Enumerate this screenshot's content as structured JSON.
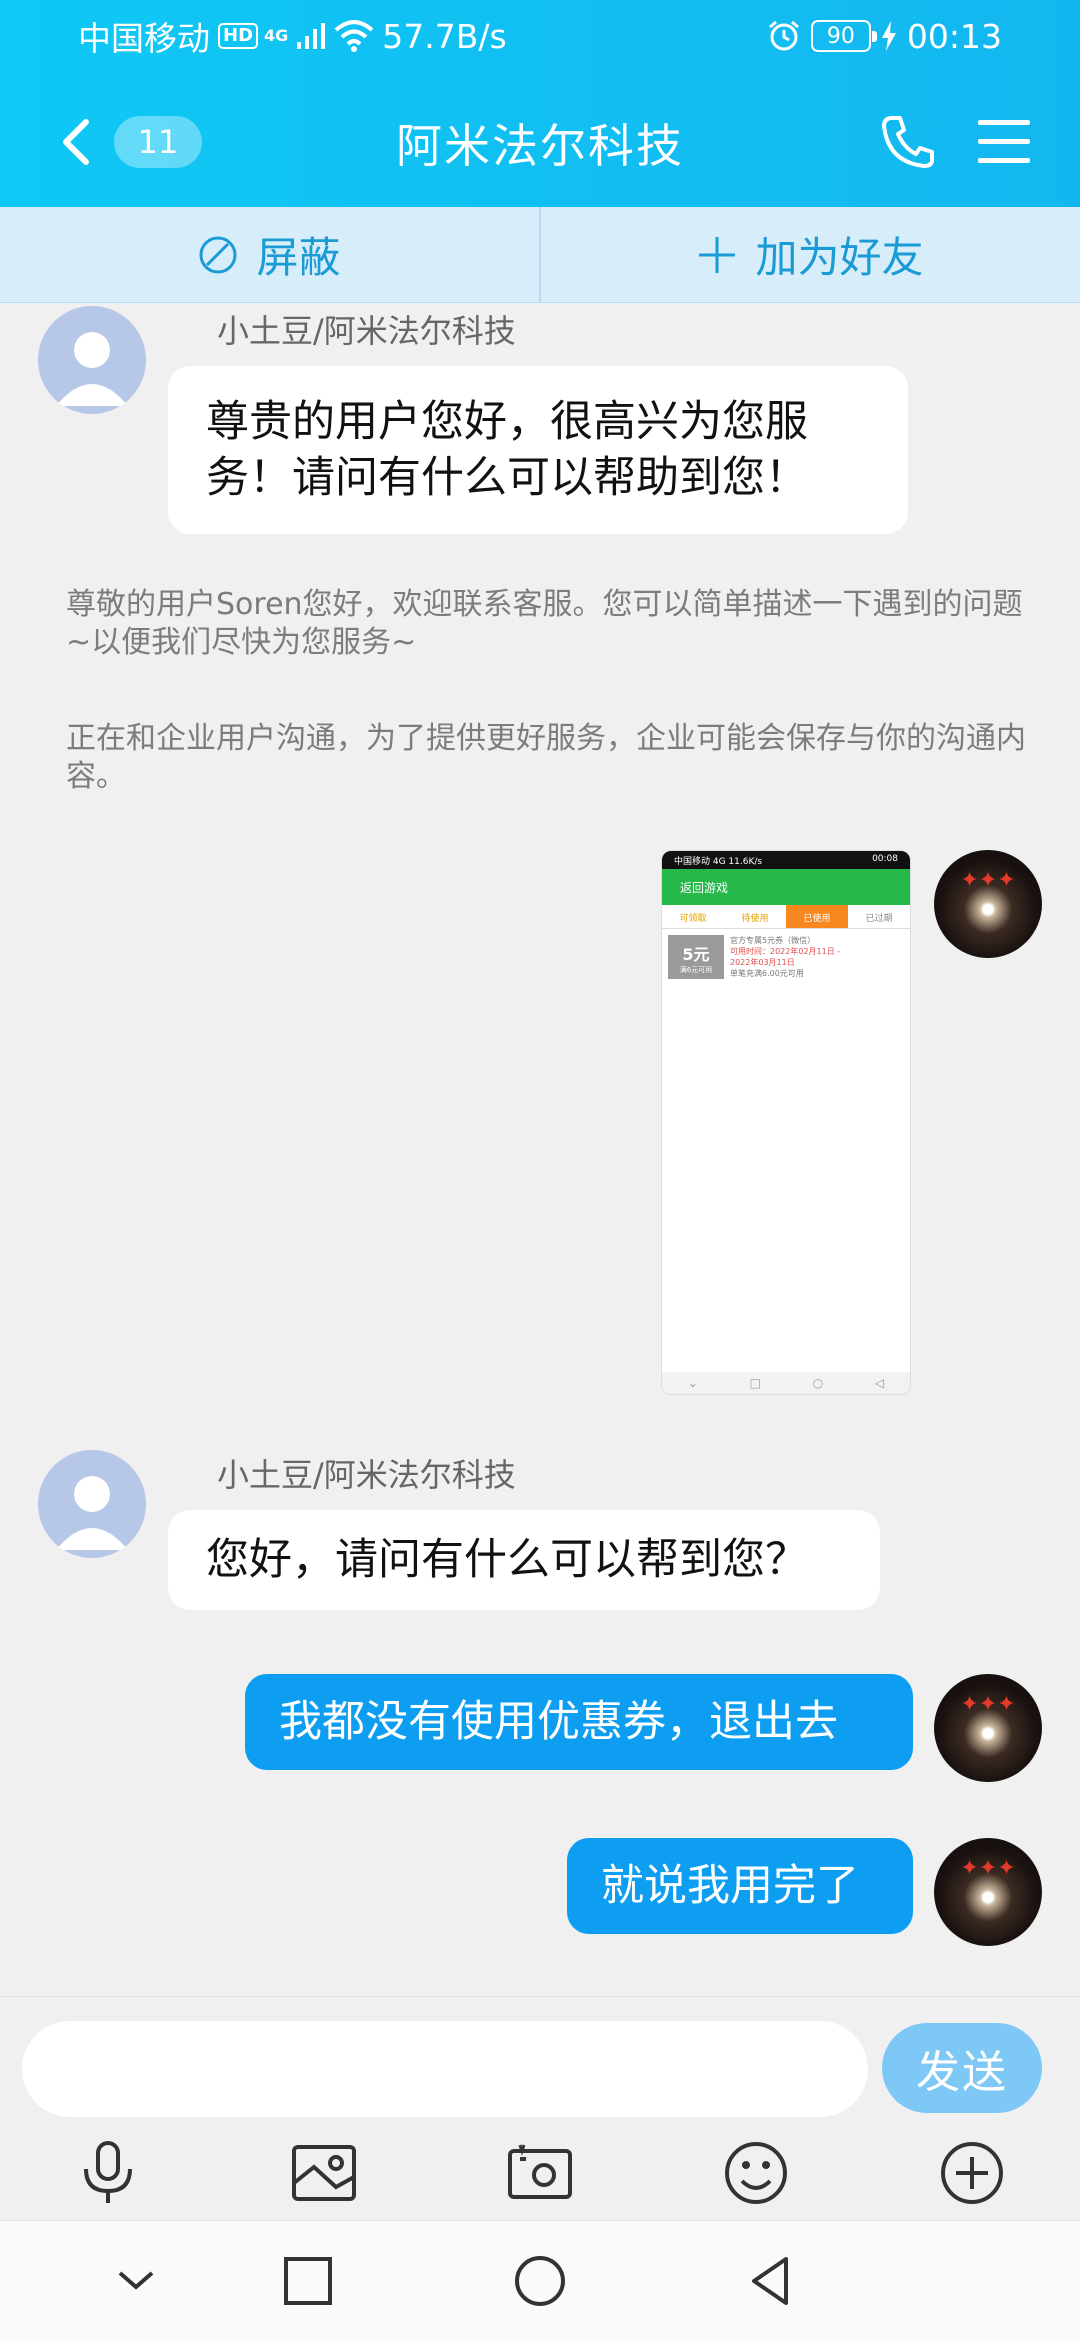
{
  "status_bar": {
    "carrier": "中国移动",
    "hd": "HD",
    "network": "4G",
    "speed": "57.7B/s",
    "battery": "90",
    "time": "00:13"
  },
  "title_bar": {
    "unread_count": "11",
    "title": "阿米法尔科技",
    "icons": [
      "back-icon",
      "phone-icon",
      "menu-icon"
    ]
  },
  "actions": {
    "block": "屏蔽",
    "add_friend": "加为好友"
  },
  "messages": {
    "m1": {
      "sender": "小土豆/阿米法尔科技",
      "text_line1": "尊贵的用户您好，很高兴为您服",
      "text_line2": "务！请问有什么可以帮助到您！"
    },
    "sys1": "尊敬的用户Soren您好，欢迎联系客服。您可以简单描述一下遇到的问题~以便我们尽快为您服务~",
    "sys2": "正在和企业用户沟通，为了提供更好服务，企业可能会保存与你的沟通内容。",
    "m2": {
      "sender": "小土豆/阿米法尔科技",
      "text": "您好，请问有什么可以帮到您？"
    },
    "m3": {
      "text": "我都没有使用优惠券，退出去"
    },
    "m4": {
      "text": "就说我用完了"
    }
  },
  "screenshot": {
    "status_left": "中国移动 4G 11.6K/s",
    "status_right": "00:08",
    "header": "返回游戏",
    "tabs": [
      "可领取",
      "待使用",
      "已使用",
      "已过期"
    ],
    "amount": "5元",
    "amount_sub": "满6元可用",
    "coupon_title": "官方专属5元券（微信）",
    "coupon_line2": "可用时间：2022年02月11日 -",
    "coupon_line3": "2022年03月11日",
    "coupon_line4": "单笔充满6.00元可用"
  },
  "input": {
    "placeholder": "",
    "send": "发送",
    "tools": [
      "microphone-icon",
      "image-icon",
      "camera-icon",
      "emoji-icon",
      "plus-icon"
    ]
  },
  "nav": [
    "collapse-icon",
    "recents-icon",
    "home-icon",
    "back-triangle-icon"
  ]
}
